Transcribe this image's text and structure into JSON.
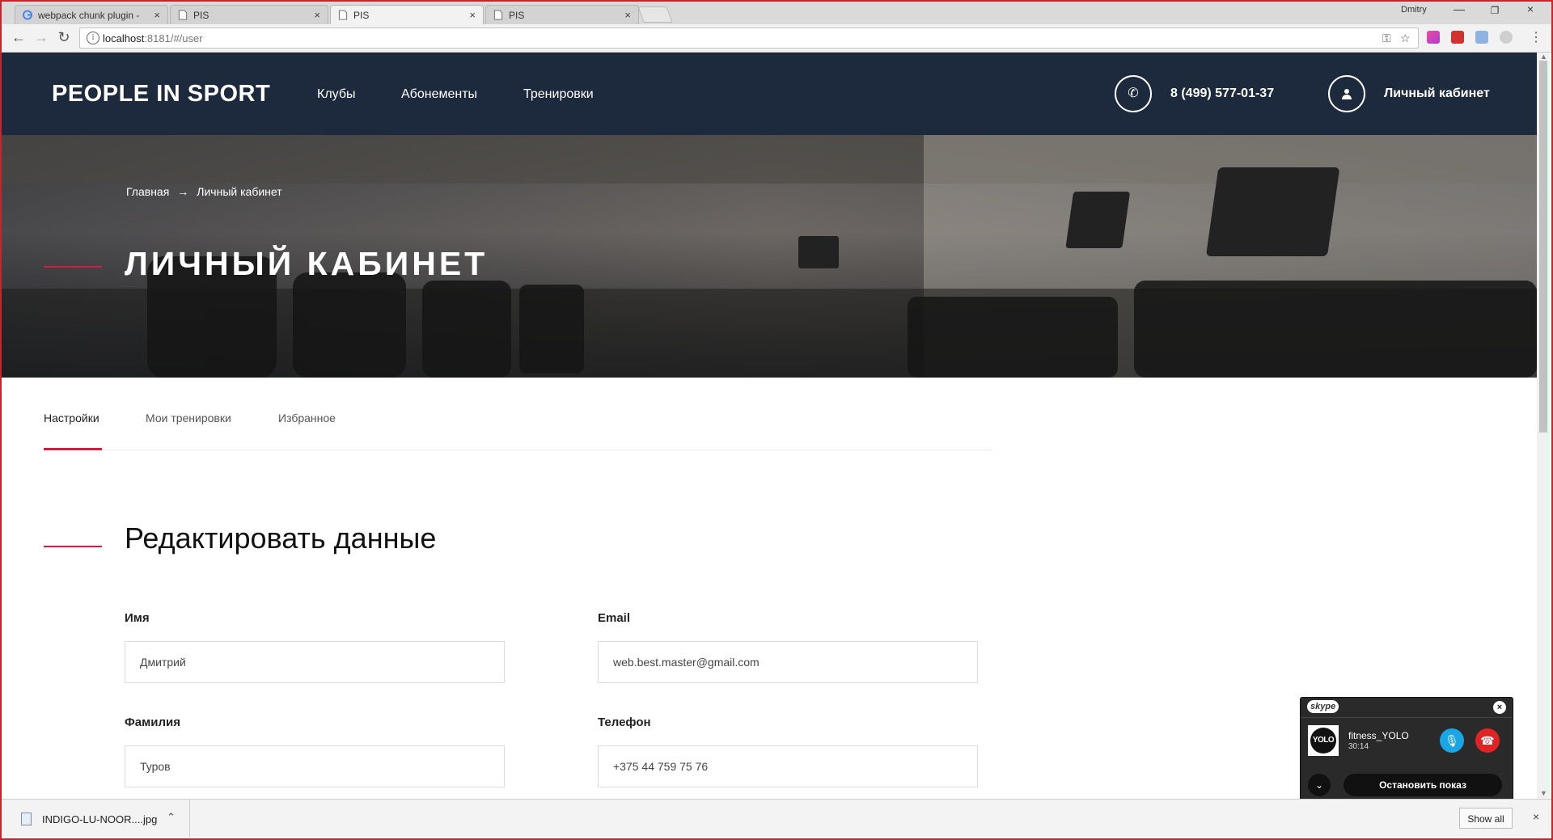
{
  "browser": {
    "tabs": [
      {
        "title": "webpack chunk plugin -",
        "icon": "google-icon",
        "active": false
      },
      {
        "title": "PIS",
        "icon": "page-icon",
        "active": false
      },
      {
        "title": "PIS",
        "icon": "page-icon",
        "active": true
      },
      {
        "title": "PIS",
        "icon": "page-icon",
        "active": false
      }
    ],
    "profile_name": "Dmitry",
    "url_host": "localhost",
    "url_rest": ":8181/#/user",
    "close_glyph": "×"
  },
  "header": {
    "logo": "PEOPLE IN SPORT",
    "nav": [
      "Клубы",
      "Абонементы",
      "Тренировки"
    ],
    "phone": "8 (499) 577-01-37",
    "cabinet": "Личный кабинет"
  },
  "hero": {
    "breadcrumb": [
      "Главная",
      "Личный кабинет"
    ],
    "breadcrumb_sep": "→",
    "title": "ЛИЧНЫЙ КАБИНЕТ"
  },
  "tabs": [
    "Настройки",
    "Мои тренировки",
    "Избранное"
  ],
  "form": {
    "title": "Редактировать данные",
    "fields": [
      {
        "label": "Имя",
        "value": "Дмитрий"
      },
      {
        "label": "Email",
        "value": "web.best.master@gmail.com"
      },
      {
        "label": "Фамилия",
        "value": "Туров"
      },
      {
        "label": "Телефон",
        "value": "+375 44 759 75 76"
      }
    ]
  },
  "skype": {
    "logo": "skype",
    "avatar_text": "YOLO",
    "contact": "fitness_YOLO",
    "duration": "30:14",
    "stop_label": "Остановить показ"
  },
  "downloads": {
    "file_name": "INDIGO-LU-NOOR....jpg",
    "show_all": "Show all"
  },
  "colors": {
    "header_bg": "#1d2a3d",
    "accent": "#d51b40",
    "window_border": "#c1272d"
  }
}
